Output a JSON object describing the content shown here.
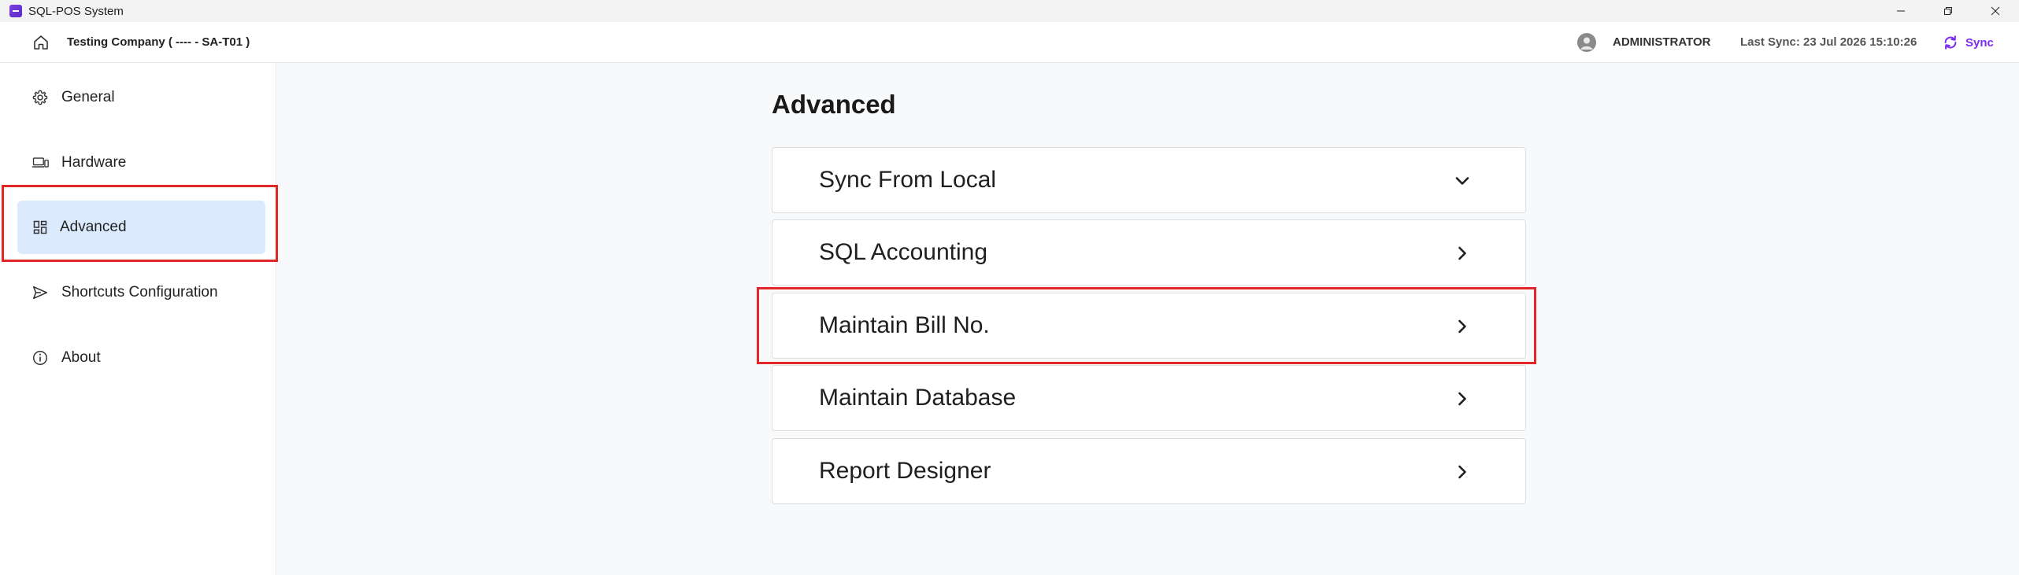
{
  "window": {
    "title": "SQL-POS System",
    "controls": [
      "minimize",
      "restore",
      "close"
    ]
  },
  "header": {
    "company": "Testing Company ( ---- - SA-T01 )",
    "user": "ADMINISTRATOR",
    "last_sync": "Last Sync: 23 Jul 2026 15:10:26",
    "sync_label": "Sync",
    "accent_color": "#7b2cf0"
  },
  "sidebar": {
    "items": [
      {
        "label": "General",
        "icon": "gear-icon"
      },
      {
        "label": "Hardware",
        "icon": "devices-icon"
      },
      {
        "label": "Advanced",
        "icon": "dashboard-icon",
        "active": true
      },
      {
        "label": "Shortcuts Configuration",
        "icon": "send-icon"
      },
      {
        "label": "About",
        "icon": "info-icon"
      }
    ],
    "active_color": "#dceafe"
  },
  "main": {
    "title": "Advanced",
    "sections": [
      {
        "label": "Sync From Local",
        "state": "expanded"
      },
      {
        "label": "SQL Accounting",
        "state": "collapsed"
      },
      {
        "label": "Maintain Bill No.",
        "state": "collapsed",
        "highlighted": true
      },
      {
        "label": "Maintain Database",
        "state": "collapsed"
      },
      {
        "label": "Report Designer",
        "state": "collapsed"
      }
    ],
    "highlight_color": "#e32626"
  }
}
